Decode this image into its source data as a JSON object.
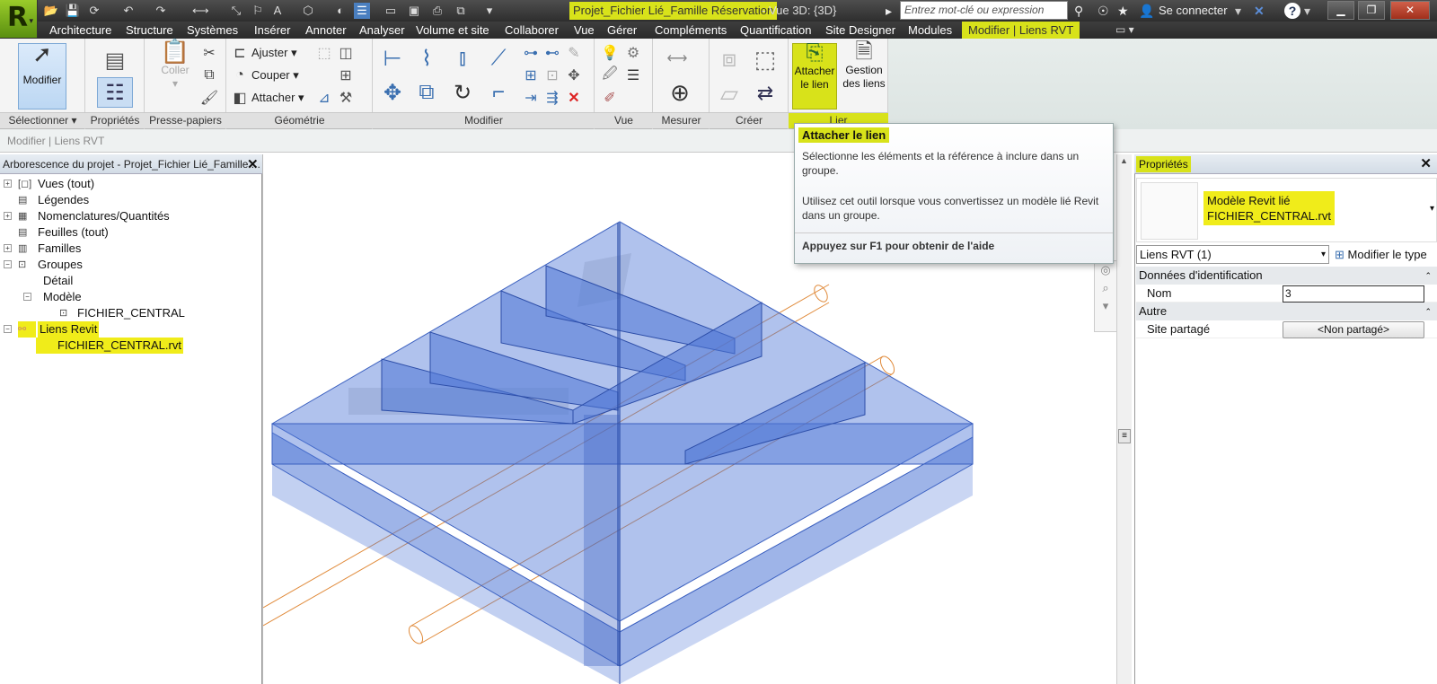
{
  "titlebar": {
    "logo": "R",
    "doc_title_highlight": "Projet_Fichier Lié_Famille Réservation",
    "doc_title_view": " - Vue 3D: {3D}",
    "search_placeholder": "Entrez mot-clé ou expression",
    "login": "Se connecter",
    "help": "?"
  },
  "menu": {
    "items": [
      "Architecture",
      "Structure",
      "Systèmes",
      "Insérer",
      "Annoter",
      "Analyser",
      "Volume et site",
      "Collaborer",
      "Vue",
      "Gérer",
      "Compléments",
      "Quantification",
      "Site Designer",
      "Modules",
      "Modifier | Liens RVT"
    ]
  },
  "ribbon": {
    "modifier": "Modifier",
    "coller": "Coller",
    "ajuster": "Ajuster",
    "couper": "Couper",
    "attacher": "Attacher",
    "attacher_lien": [
      "Attacher",
      "le lien"
    ],
    "gestion_liens": [
      "Gestion",
      "des liens"
    ],
    "panels": [
      "Sélectionner ▾",
      "Propriétés",
      "Presse-papiers",
      "Géométrie",
      "Modifier",
      "Vue",
      "Mesurer",
      "Créer",
      "Lier"
    ]
  },
  "options_bar": "Modifier | Liens RVT",
  "browser": {
    "title": "Arborescence du projet - Projet_Fichier Lié_Famille ...",
    "items": [
      {
        "label": "Vues (tout)",
        "level": 0,
        "toggle": "+"
      },
      {
        "label": "Légendes",
        "level": 0,
        "toggle": ""
      },
      {
        "label": "Nomenclatures/Quantités",
        "level": 0,
        "toggle": "+"
      },
      {
        "label": "Feuilles (tout)",
        "level": 0,
        "toggle": ""
      },
      {
        "label": "Familles",
        "level": 0,
        "toggle": "+"
      },
      {
        "label": "Groupes",
        "level": 0,
        "toggle": "−"
      },
      {
        "label": "Détail",
        "level": 1,
        "toggle": ""
      },
      {
        "label": "Modèle",
        "level": 1,
        "toggle": "−"
      },
      {
        "label": "FICHIER_CENTRAL",
        "level": 2,
        "toggle": ""
      },
      {
        "label": "Liens Revit",
        "level": 0,
        "toggle": "−"
      },
      {
        "label": "FICHIER_CENTRAL.rvt",
        "level": 1,
        "toggle": ""
      }
    ]
  },
  "tooltip": {
    "title": "Attacher le lien",
    "p1": "Sélectionne les éléments et la référence à inclure dans un groupe.",
    "p2": "Utilisez cet outil lorsque vous convertissez un modèle lié Revit dans un groupe.",
    "help": "Appuyez sur F1 pour obtenir de l'aide"
  },
  "properties": {
    "title": "Propriétés",
    "type_line1": "Modèle Revit lié",
    "type_line2": "FICHIER_CENTRAL.rvt",
    "selector": "Liens RVT (1)",
    "edit_type": "Modifier le type",
    "group1": "Données d'identification",
    "nom_label": "Nom",
    "nom_value": "3",
    "group2": "Autre",
    "site_label": "Site partagé",
    "site_value": "<Non partagé>"
  },
  "colors": {
    "highlight": "#d8e21a",
    "model_fill": "#4f77d6",
    "pipe": "#e08a3a"
  }
}
